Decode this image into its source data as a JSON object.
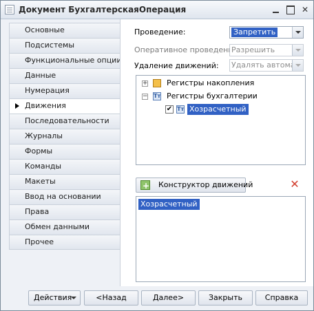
{
  "window": {
    "title": "Документ БухгалтерскаяОперация"
  },
  "tabs": [
    {
      "label": "Основные",
      "active": false
    },
    {
      "label": "Подсистемы",
      "active": false
    },
    {
      "label": "Функциональные опции",
      "active": false
    },
    {
      "label": "Данные",
      "active": false
    },
    {
      "label": "Нумерация",
      "active": false
    },
    {
      "label": "Движения",
      "active": true
    },
    {
      "label": "Последовательности",
      "active": false
    },
    {
      "label": "Журналы",
      "active": false
    },
    {
      "label": "Формы",
      "active": false
    },
    {
      "label": "Команды",
      "active": false
    },
    {
      "label": "Макеты",
      "active": false
    },
    {
      "label": "Ввод на основании",
      "active": false
    },
    {
      "label": "Права",
      "active": false
    },
    {
      "label": "Обмен данными",
      "active": false
    },
    {
      "label": "Прочее",
      "active": false
    }
  ],
  "fields": {
    "posting_label": "Проведение:",
    "posting_value": "Запретить",
    "realtime_posting_label": "Оперативное проведение:",
    "realtime_posting_value": "Разрешить",
    "delete_movements_label": "Удаление движений:",
    "delete_movements_value": "Удалять автомат"
  },
  "tree": {
    "accumulation_registers": "Регистры накопления",
    "accounting_registers": "Регистры бухгалтерии",
    "accounting_child": "Хозрасчетный",
    "accounting_child_checked": true
  },
  "movements": {
    "constructor_button": "Конструктор движений",
    "items": [
      "Хозрасчетный"
    ]
  },
  "footer": {
    "actions": "Действия",
    "back": "<Назад",
    "next": "Далее>",
    "close": "Закрыть",
    "help": "Справка"
  },
  "colors": {
    "selection": "#3161c4",
    "delete_icon": "#d23b2b"
  }
}
